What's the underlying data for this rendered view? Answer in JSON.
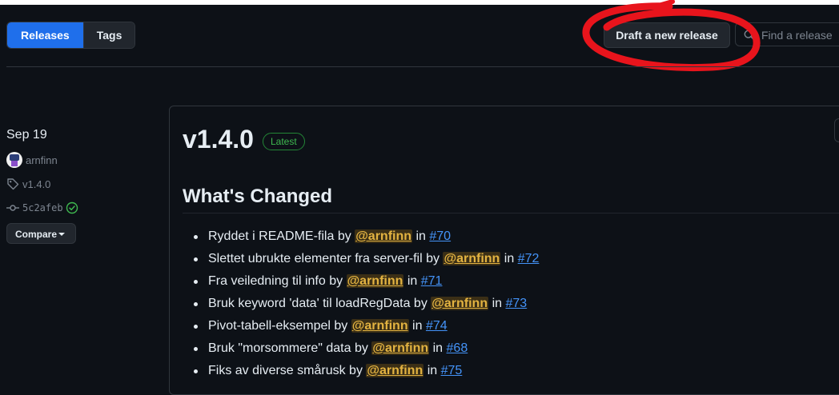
{
  "tabs": [
    {
      "label": "Releases",
      "active": true
    },
    {
      "label": "Tags",
      "active": false
    }
  ],
  "actions": {
    "draft_label": "Draft a new release",
    "find_placeholder": "Find a release"
  },
  "sidebar": {
    "date": "Sep 19",
    "author": "arnfinn",
    "tag": "v1.4.0",
    "commit": "5c2afeb",
    "compare_label": "Compare"
  },
  "release": {
    "version": "v1.4.0",
    "badge": "Latest",
    "section_heading": "What's Changed",
    "changes": [
      {
        "text": "Ryddet i README-fila",
        "by": "by",
        "user": "@arnfinn",
        "in": "in",
        "pr": "#70"
      },
      {
        "text": "Slettet ubrukte elementer fra server-fil",
        "by": "by",
        "user": "@arnfinn",
        "in": "in",
        "pr": "#72"
      },
      {
        "text": "Fra veiledning til info",
        "by": "by",
        "user": "@arnfinn",
        "in": "in",
        "pr": "#71"
      },
      {
        "text": "Bruk keyword 'data' til loadRegData",
        "by": "by",
        "user": "@arnfinn",
        "in": "in",
        "pr": "#73"
      },
      {
        "text": "Pivot-tabell-eksempel",
        "by": "by",
        "user": "@arnfinn",
        "in": "in",
        "pr": "#74"
      },
      {
        "text": "Bruk \"morsommere\" data",
        "by": "by",
        "user": "@arnfinn",
        "in": "in",
        "pr": "#68"
      },
      {
        "text": "Fiks av diverse smårusk",
        "by": "by",
        "user": "@arnfinn",
        "in": "in",
        "pr": "#75"
      }
    ]
  },
  "colors": {
    "background": "#0d1117",
    "accent": "#1f6feb",
    "latest_green": "#3fb950",
    "mention_gold": "#e3b341",
    "link_blue": "#4493f8",
    "annotation_red": "#e8141c"
  },
  "icons": [
    "avatar",
    "tag-icon",
    "commit-icon",
    "verified-icon",
    "search-icon",
    "chevron-down-icon"
  ]
}
